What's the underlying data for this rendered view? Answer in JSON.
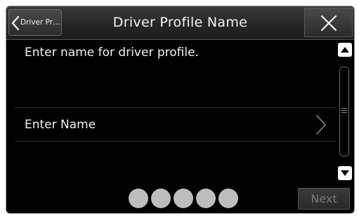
{
  "header": {
    "back_label": "Driver Pr…",
    "title": "Driver Profile Name"
  },
  "main": {
    "prompt": "Enter name for driver profile.",
    "name_row_label": "Enter Name"
  },
  "pager": {
    "page_count": 5
  },
  "footer": {
    "next_label": "Next",
    "next_enabled": false
  },
  "icons": [
    "chevron-left-icon",
    "close-icon",
    "chevron-right-icon",
    "scroll-up-icon",
    "scroll-down-icon"
  ]
}
